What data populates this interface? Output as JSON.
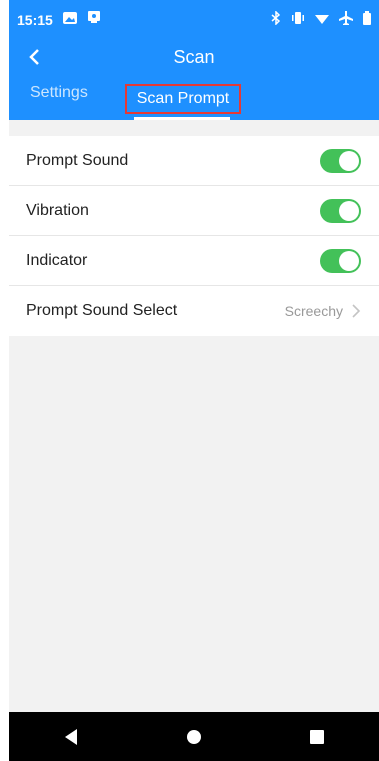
{
  "status": {
    "time": "15:15",
    "icons": [
      "image-icon",
      "cast-icon",
      "bluetooth-icon",
      "vibrate-icon",
      "wifi-icon",
      "airplane-icon",
      "battery-icon"
    ]
  },
  "appbar": {
    "title": "Scan"
  },
  "tabs": [
    {
      "label": "Settings"
    },
    {
      "label": "Scan Prompt"
    }
  ],
  "settings": [
    {
      "label": "Prompt Sound",
      "type": "toggle",
      "on": true
    },
    {
      "label": "Vibration",
      "type": "toggle",
      "on": true
    },
    {
      "label": "Indicator",
      "type": "toggle",
      "on": true
    },
    {
      "label": "Prompt Sound Select",
      "type": "select",
      "value": "Screechy"
    }
  ],
  "colors": {
    "primary": "#1e90ff",
    "toggle_on": "#43c159",
    "highlight": "#e53935"
  }
}
